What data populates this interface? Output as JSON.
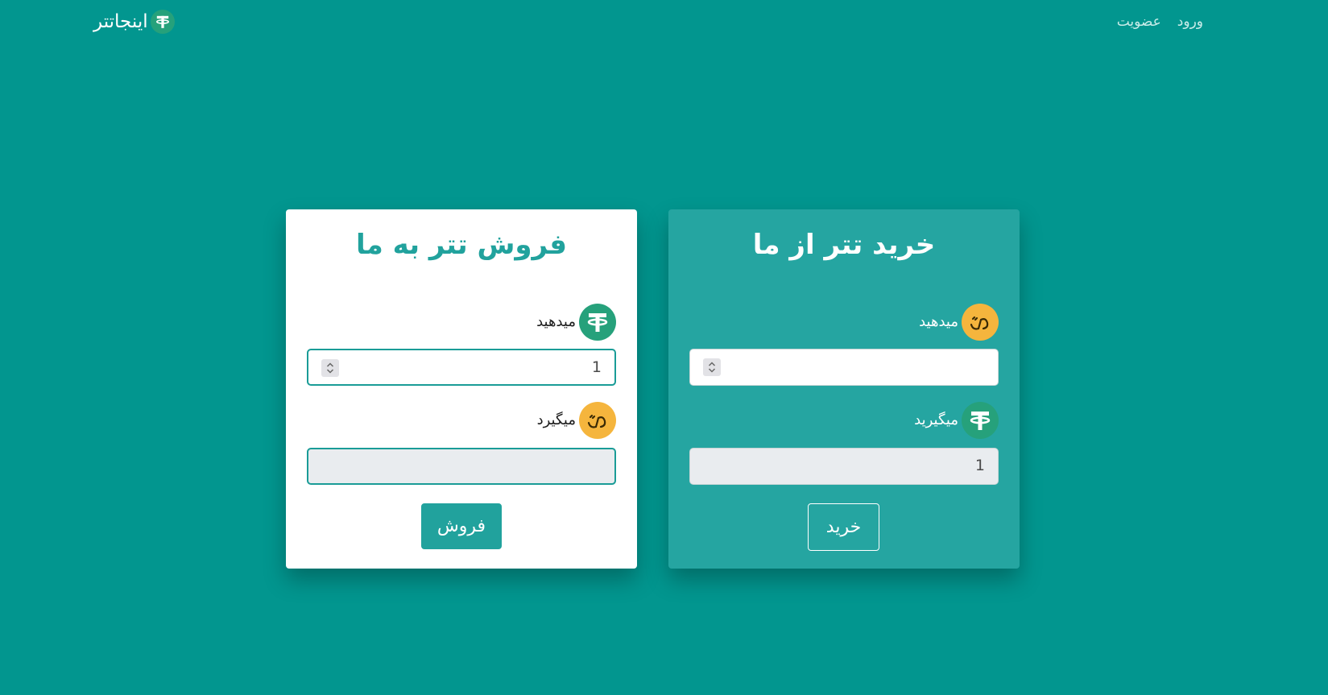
{
  "navbar": {
    "brand_name": "اینجاتتر",
    "brand_icon": "tether-coin-icon",
    "links": [
      {
        "label": "ورود"
      },
      {
        "label": "عضویت"
      }
    ]
  },
  "sell_card": {
    "title": "فروش تتر به ما",
    "give_label": "میدهید",
    "give_icon": "tether-coin-icon",
    "give_value": "1",
    "get_label": "میگیرد",
    "get_icon": "toman-coin-icon",
    "get_value": "",
    "button_label": "فروش"
  },
  "buy_card": {
    "title": "خرید تتر از ما",
    "give_label": "میدهید",
    "give_icon": "toman-coin-icon",
    "give_value": "",
    "get_label": "میگیرید",
    "get_icon": "tether-coin-icon",
    "get_value": "1",
    "button_label": "خرید"
  },
  "colors": {
    "page_background": "#02968f",
    "accent": "#21a29d",
    "buy_card_background": "#25a5a1",
    "tether_green": "#26a17b",
    "toman_gold": "#f5b53d"
  }
}
